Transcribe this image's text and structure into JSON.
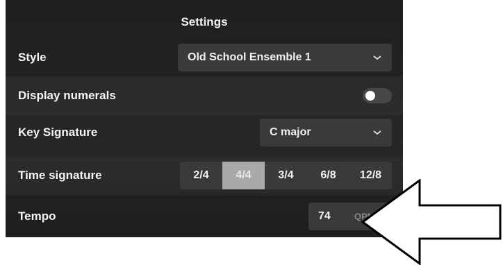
{
  "panel": {
    "title": "Settings"
  },
  "style": {
    "label": "Style",
    "value": "Old School Ensemble 1"
  },
  "display_numerals": {
    "label": "Display numerals",
    "enabled": false
  },
  "key_signature": {
    "label": "Key Signature",
    "value": "C major"
  },
  "time_signature": {
    "label": "Time signature",
    "options": [
      "2/4",
      "4/4",
      "3/4",
      "6/8",
      "12/8"
    ],
    "selected": "4/4"
  },
  "tempo": {
    "label": "Tempo",
    "value": "74",
    "unit": "QPM"
  },
  "icons": {
    "dropdown": "chevron-down-icon",
    "annotation": "left-arrow-icon"
  },
  "colors": {
    "panel_bg": "#232323",
    "control_bg": "#3a3a3a",
    "selected_segment": "#a9a9a9"
  }
}
